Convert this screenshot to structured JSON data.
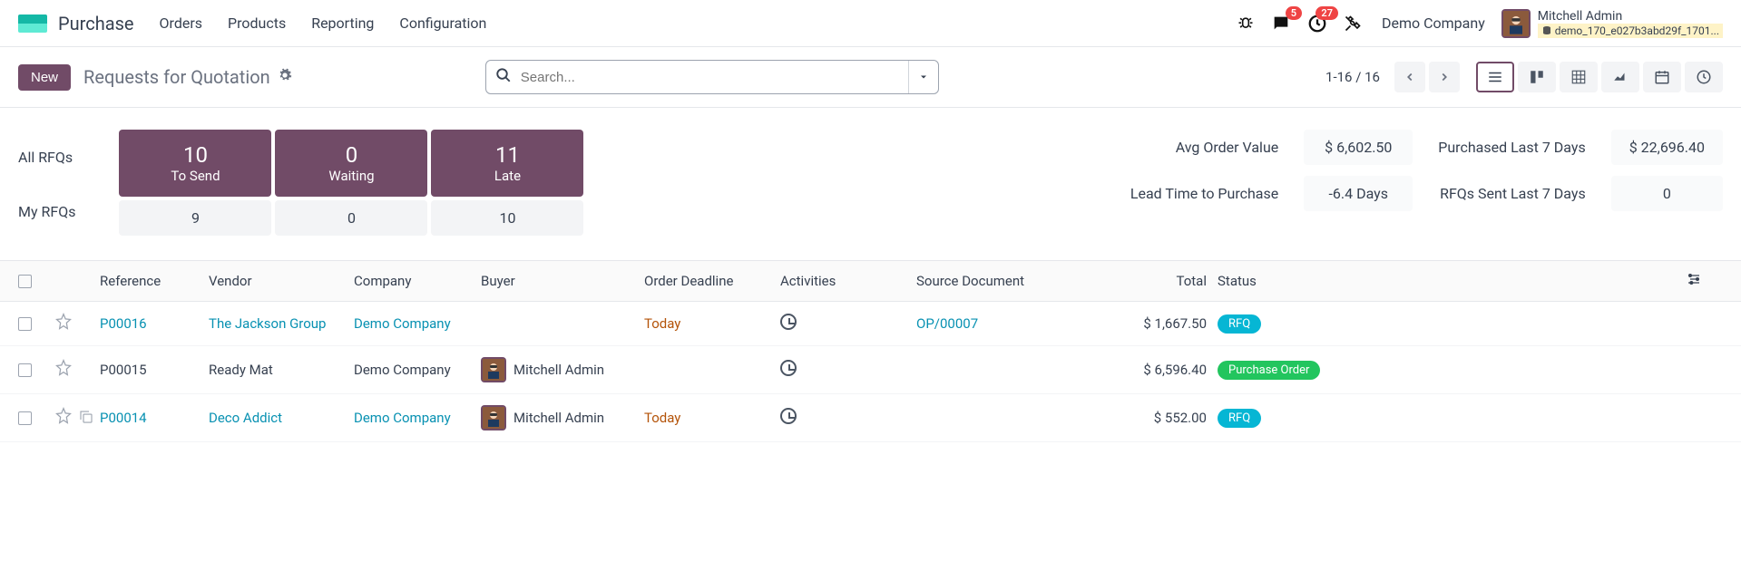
{
  "app": {
    "title": "Purchase"
  },
  "nav": {
    "orders": "Orders",
    "products": "Products",
    "reporting": "Reporting",
    "configuration": "Configuration"
  },
  "badges": {
    "messages": "5",
    "activities": "27"
  },
  "company": {
    "name": "Demo Company"
  },
  "user": {
    "name": "Mitchell Admin",
    "db": "demo_170_e027b3abd29f_1701..."
  },
  "controls": {
    "new": "New",
    "title": "Requests for Quotation",
    "search_placeholder": "Search...",
    "pager": "1-16 / 16"
  },
  "dashboard": {
    "all_label": "All RFQs",
    "my_label": "My RFQs",
    "tosend": {
      "num": "10",
      "lbl": "To Send",
      "my": "9"
    },
    "waiting": {
      "num": "0",
      "lbl": "Waiting",
      "my": "0"
    },
    "late": {
      "num": "11",
      "lbl": "Late",
      "my": "10"
    },
    "avg_label": "Avg Order Value",
    "avg_val": "$ 6,602.50",
    "purchased_label": "Purchased Last 7 Days",
    "purchased_val": "$ 22,696.40",
    "lead_label": "Lead Time to Purchase",
    "lead_val": "-6.4 Days",
    "sent_label": "RFQs Sent Last 7 Days",
    "sent_val": "0"
  },
  "headers": {
    "reference": "Reference",
    "vendor": "Vendor",
    "company": "Company",
    "buyer": "Buyer",
    "deadline": "Order Deadline",
    "activities": "Activities",
    "source": "Source Document",
    "total": "Total",
    "status": "Status"
  },
  "rows": [
    {
      "ref": "P00016",
      "ref_link": true,
      "vendor": "The Jackson Group",
      "vendor_link": true,
      "company": "Demo Company",
      "company_link": true,
      "buyer": "",
      "deadline": "Today",
      "deadline_today": true,
      "source": "OP/00007",
      "source_link": true,
      "total": "$ 1,667.50",
      "status": "RFQ",
      "status_class": "pill-rfq"
    },
    {
      "ref": "P00015",
      "ref_link": false,
      "vendor": "Ready Mat",
      "vendor_link": false,
      "company": "Demo Company",
      "company_link": false,
      "buyer": "Mitchell Admin",
      "deadline": "",
      "deadline_today": false,
      "source": "",
      "source_link": false,
      "total": "$ 6,596.40",
      "status": "Purchase Order",
      "status_class": "pill-po"
    },
    {
      "ref": "P00014",
      "ref_link": true,
      "vendor": "Deco Addict",
      "vendor_link": true,
      "company": "Demo Company",
      "company_link": true,
      "buyer": "Mitchell Admin",
      "deadline": "Today",
      "deadline_today": true,
      "source": "",
      "source_link": false,
      "total": "$ 552.00",
      "status": "RFQ",
      "status_class": "pill-rfq"
    }
  ]
}
